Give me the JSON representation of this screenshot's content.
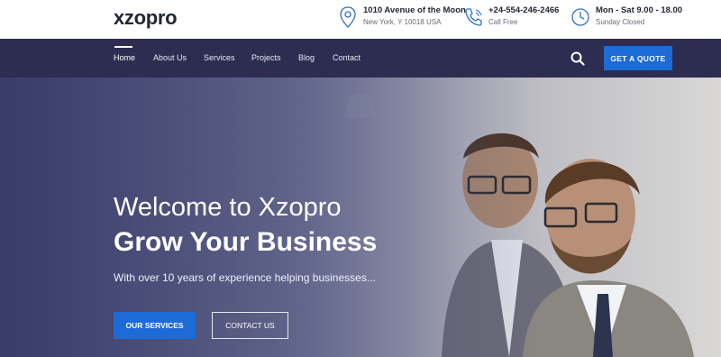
{
  "brand": {
    "logo": "xzopro"
  },
  "contact_info": [
    {
      "icon": "map-pin-icon",
      "line1": "1010 Avenue of the Moon",
      "line2": "New York, Y 10018 USA"
    },
    {
      "icon": "phone-icon",
      "line1": "+24-554-246-2466",
      "line2": "Call Free"
    },
    {
      "icon": "clock-icon",
      "line1": "Mon - Sat 9.00 - 18.00",
      "line2": "Sunday Closed"
    }
  ],
  "nav": {
    "items": [
      {
        "label": "Home",
        "active": true
      },
      {
        "label": "About Us"
      },
      {
        "label": "Services"
      },
      {
        "label": "Projects"
      },
      {
        "label": "Blog"
      },
      {
        "label": "Contact"
      }
    ],
    "search_icon": "search-icon",
    "quote_label": "GET A QUOTE"
  },
  "hero": {
    "title_line1": "Welcome to Xzopro",
    "title_line2": "Grow Your Business",
    "subtitle": "With over 10 years of experience helping businesses...",
    "primary_button": "OUR SERVICES",
    "secondary_button": "CONTACT US"
  },
  "colors": {
    "nav_bg": "#2d2d52",
    "accent": "#1c6bd6",
    "icon_blue": "#2f6fd0"
  }
}
